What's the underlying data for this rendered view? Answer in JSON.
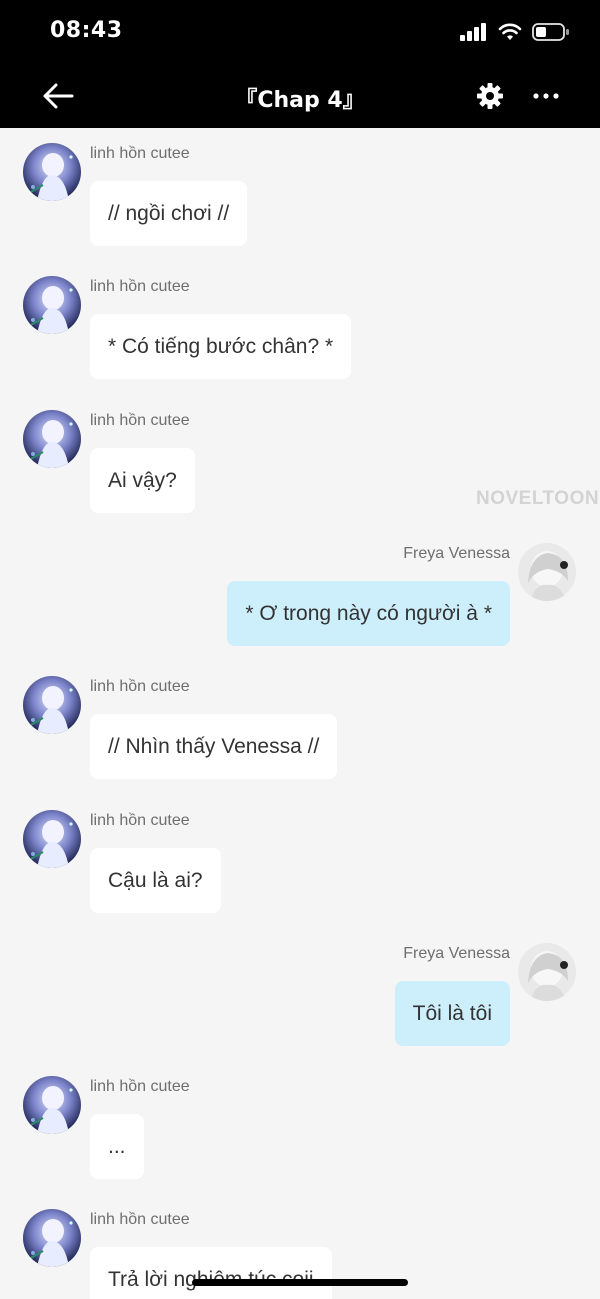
{
  "status_bar": {
    "time": "08:43",
    "icons": [
      "signal-icon",
      "wifi-icon",
      "battery-icon"
    ]
  },
  "nav": {
    "title": "『Chap 4』",
    "back_icon": "arrow-left-icon",
    "settings_icon": "gear-icon",
    "more_icon": "more-horizontal-icon"
  },
  "messages": [
    {
      "side": "left",
      "sender": "linh hồn cutee",
      "text": "// ngồi chơi //"
    },
    {
      "side": "left",
      "sender": "linh hồn cutee",
      "text": "* Có tiếng bước chân? *"
    },
    {
      "side": "left",
      "sender": "linh hồn cutee",
      "text": "Ai vậy?"
    },
    {
      "side": "right",
      "sender": "Freya Venessa",
      "text": "* Ơ trong này có người à *"
    },
    {
      "side": "left",
      "sender": "linh hồn cutee",
      "text": "// Nhìn thấy Venessa //"
    },
    {
      "side": "left",
      "sender": "linh hồn cutee",
      "text": "Cậu là ai?"
    },
    {
      "side": "right",
      "sender": "Freya Venessa",
      "text": "Tôi là tôi"
    },
    {
      "side": "left",
      "sender": "linh hồn cutee",
      "text": "..."
    },
    {
      "side": "left",
      "sender": "linh hồn cutee",
      "text": "Trả lời nghiêm túc coii"
    }
  ],
  "watermark": "NOVELTOON",
  "colors": {
    "bar_bg": "#000000",
    "chat_bg": "#f5f5f5",
    "bubble_left": "#ffffff",
    "bubble_right": "#cdeefb",
    "sender_text": "#6e6e6e"
  }
}
